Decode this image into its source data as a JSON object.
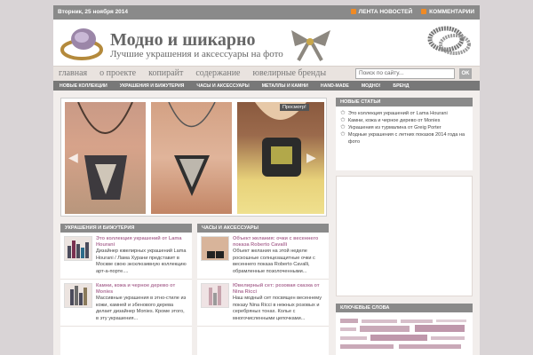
{
  "topbar": {
    "date": "Вторник, 25 ноября 2014",
    "rss_news": "ЛЕНТА НОВОСТЕЙ",
    "rss_comments": "КОММЕНТАРИИ"
  },
  "header": {
    "title": "Модно и шикарно",
    "tagline": "Лучшие украшения и аксессуары на фото"
  },
  "nav": {
    "items": [
      "главная",
      "о проекте",
      "копирайт",
      "содержание",
      "ювелирные бренды"
    ],
    "search_placeholder": "Поиск по сайту...",
    "ok": "OK"
  },
  "subnav": {
    "items": [
      "НОВЫЕ КОЛЛЕКЦИИ",
      "УКРАШЕНИЯ И БИЖУТЕРИЯ",
      "ЧАСЫ И АКСЕССУАРЫ",
      "МЕТАЛЛЫ И КАМНИ",
      "HAND-MADE",
      "МОДНО!",
      "БРЕНД"
    ]
  },
  "slider": {
    "view_label": "Просмотр!"
  },
  "news": {
    "heading": "НОВЫЕ СТАТЬИ",
    "items": [
      "Это коллекция украшений от Lama Hourani",
      "Камни, кожа и черное дерево от Monies",
      "Украшения из турмалина от Greig Porter",
      "Модные украшения с летних показов 2014 года на фото"
    ]
  },
  "tags": {
    "heading": "КЛЮЧЕВЫЕ СЛОВА"
  },
  "col1": {
    "heading": "УКРАШЕНИЯ И БИЖУТЕРИЯ",
    "articles": [
      {
        "title": "Это коллекция украшений от Lama Hourani",
        "desc": "Дизайнер ювелирных украшений Lama Hourani / Лама Хурани представит в Москве свою эксклюзивную коллекцию арт-а-порте...."
      },
      {
        "title": "Камни, кожа и черное дерево от Monies",
        "desc": "Массивные украшения в этно-стиле из кожи, камней и эбенового дерева делает дизайнер Monies. Кроме этого, в эту украшения..."
      }
    ]
  },
  "col2": {
    "heading": "ЧАСЫ И АКСЕССУАРЫ",
    "articles": [
      {
        "title": "Объект желания: очки с весеннего показа Roberto Cavalli",
        "desc": "Объект желания на этой неделе роскошные солнцезащитные очки с весеннего показа Roberto Cavalli, обрамленные позолоченными..."
      },
      {
        "title": "Ювелирный сет: розовая сказка от Nina Ricci",
        "desc": "Наш модный сет посвящен весеннему показу Nina Ricci в нежных розовых и серебряных тонах. Колье с многочисленными цепочками..."
      }
    ]
  }
}
